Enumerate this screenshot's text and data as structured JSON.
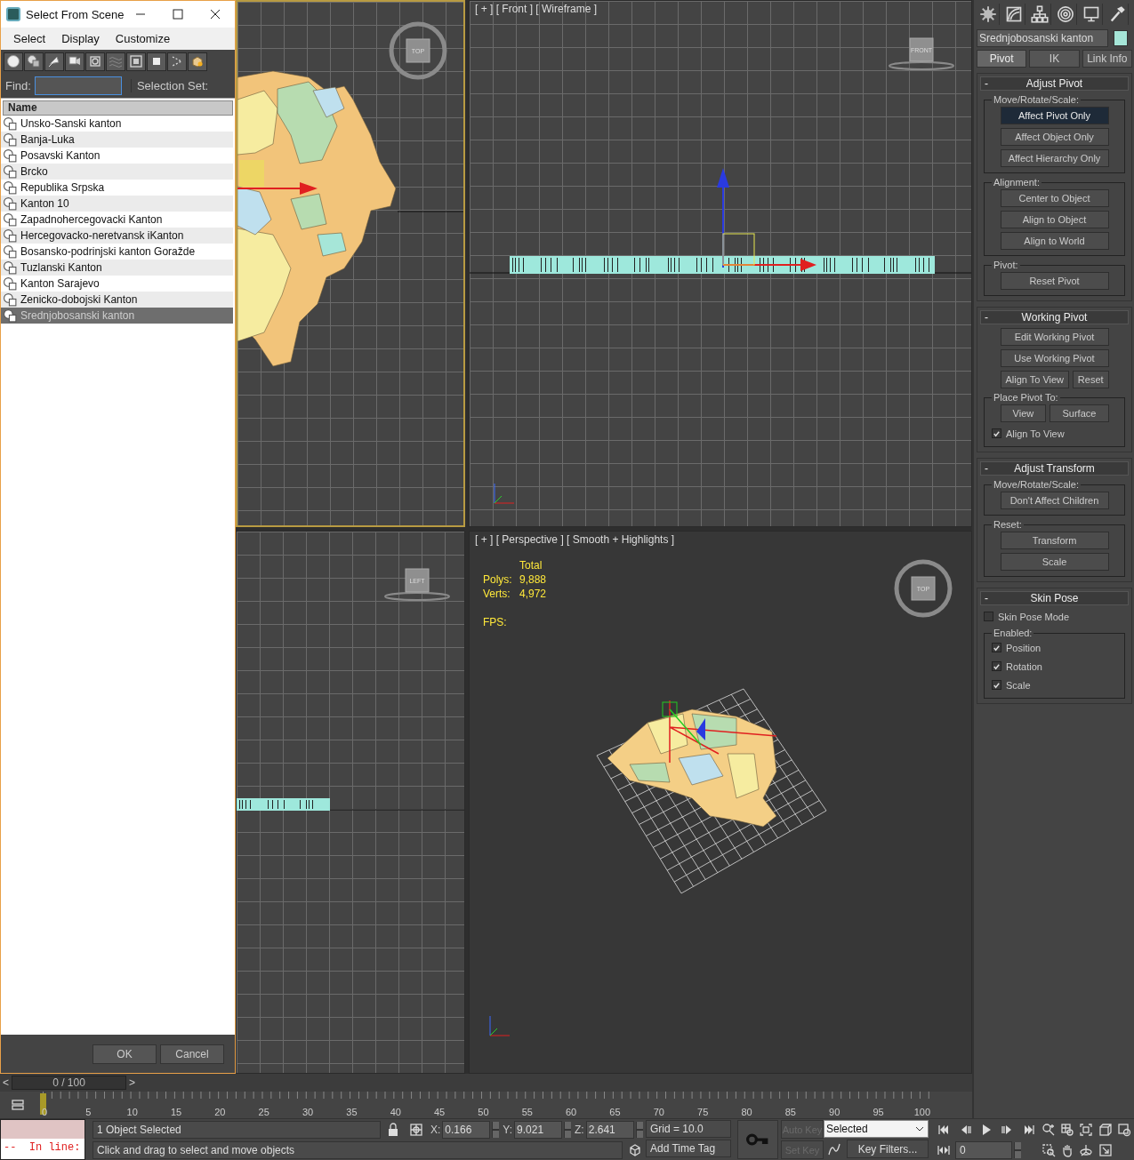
{
  "dialog": {
    "title": "Select From Scene",
    "menu": [
      "Select",
      "Display",
      "Customize"
    ],
    "find_label": "Find:",
    "selection_set_label": "Selection Set:",
    "column": "Name",
    "rows": [
      {
        "name": "Unsko-Sanski kanton",
        "selected": false
      },
      {
        "name": "Banja-Luka",
        "selected": false
      },
      {
        "name": "Posavski Kanton",
        "selected": false
      },
      {
        "name": "Brcko",
        "selected": false
      },
      {
        "name": "Republika Srpska",
        "selected": false
      },
      {
        "name": "Kanton 10",
        "selected": false
      },
      {
        "name": "Zapadnohercegovacki Kanton",
        "selected": false
      },
      {
        "name": "Hercegovacko-neretvansk iKanton",
        "selected": false
      },
      {
        "name": "Bosansko-podrinjski kanton Goražde",
        "selected": false
      },
      {
        "name": "Tuzlanski Kanton",
        "selected": false
      },
      {
        "name": "Kanton Sarajevo",
        "selected": false
      },
      {
        "name": "Zenicko-dobojski Kanton",
        "selected": false
      },
      {
        "name": "Srednjobosanski kanton",
        "selected": true
      }
    ],
    "buttons": [
      "OK",
      "Cancel"
    ]
  },
  "viewports": [
    {
      "kind": "top",
      "active": true,
      "cube_label": "TOP"
    },
    {
      "kind": "front",
      "active": false,
      "label": "[ + ] [ Front ] [ Wireframe ]",
      "cube_label": "FRONT"
    },
    {
      "kind": "left",
      "active": false,
      "cube_label": "LEFT"
    },
    {
      "kind": "perspective",
      "active": false,
      "label": "[ + ] [ Perspective ] [ Smooth + Highlights ]",
      "cube_label": "TOP",
      "stats": {
        "header": "Total",
        "rows": [
          {
            "label": "Polys:",
            "value": "9,888"
          },
          {
            "label": "Verts:",
            "value": "4,972"
          }
        ],
        "fps": "FPS:"
      }
    }
  ],
  "command_panel": {
    "object": {
      "name": "Srednjobosanski kanton",
      "color": "#a6e6d8"
    },
    "tabs": [
      {
        "label": "Pivot",
        "selected": true
      },
      {
        "label": "IK",
        "selected": false
      },
      {
        "label": "Link Info",
        "selected": false
      }
    ],
    "rollouts": [
      {
        "title": "Adjust Pivot",
        "collapse": "-",
        "items": [
          {
            "kind": "group",
            "title": "Move/Rotate/Scale:",
            "items": [
              {
                "kind": "button",
                "label": "Affect Pivot Only",
                "selected": true
              },
              {
                "kind": "button",
                "label": "Affect Object Only",
                "selected": false
              },
              {
                "kind": "button",
                "label": "Affect Hierarchy Only",
                "selected": false
              }
            ]
          },
          {
            "kind": "group",
            "title": "Alignment:",
            "items": [
              {
                "kind": "button",
                "label": "Center to Object"
              },
              {
                "kind": "button",
                "label": "Align to Object"
              },
              {
                "kind": "button",
                "label": "Align to World"
              }
            ]
          },
          {
            "kind": "group",
            "title": "Pivot:",
            "items": [
              {
                "kind": "button",
                "label": "Reset Pivot"
              }
            ]
          }
        ]
      },
      {
        "title": "Working Pivot",
        "collapse": "-",
        "items": [
          {
            "kind": "button",
            "label": "Edit Working Pivot"
          },
          {
            "kind": "button",
            "label": "Use Working Pivot"
          },
          {
            "kind": "button_row",
            "buttons": [
              "Align To View",
              "Reset"
            ]
          },
          {
            "kind": "group",
            "title": "Place Pivot To:",
            "items": [
              {
                "kind": "button_row",
                "buttons": [
                  "View",
                  "Surface"
                ]
              },
              {
                "kind": "checkbox",
                "label": "Align To View",
                "checked": true
              }
            ]
          }
        ]
      },
      {
        "title": "Adjust Transform",
        "collapse": "-",
        "items": [
          {
            "kind": "group",
            "title": "Move/Rotate/Scale:",
            "items": [
              {
                "kind": "button",
                "label": "Don't Affect Children"
              }
            ]
          },
          {
            "kind": "group",
            "title": "Reset:",
            "items": [
              {
                "kind": "button",
                "label": "Transform"
              },
              {
                "kind": "button",
                "label": "Scale"
              }
            ]
          }
        ]
      },
      {
        "title": "Skin Pose",
        "collapse": "-",
        "items": [
          {
            "kind": "checkbox",
            "label": "Skin Pose Mode",
            "checked": false
          },
          {
            "kind": "group",
            "title": "Enabled:",
            "items": [
              {
                "kind": "checkbox",
                "label": "Position",
                "checked": true
              },
              {
                "kind": "checkbox",
                "label": "Rotation",
                "checked": true
              },
              {
                "kind": "checkbox",
                "label": "Scale",
                "checked": true
              }
            ]
          }
        ]
      }
    ]
  },
  "time_slider": {
    "prev": "<",
    "label": "0 / 100",
    "next": ">"
  },
  "track_bar": {
    "ticks": [
      "0",
      "5",
      "10",
      "15",
      "20",
      "25",
      "30",
      "35",
      "40",
      "45",
      "50",
      "55",
      "60",
      "65",
      "70",
      "75",
      "80",
      "85",
      "90",
      "95",
      "100"
    ]
  },
  "status": {
    "script_prompt": "--  In line:",
    "selection": "1 Object Selected",
    "prompt": "Click and drag to select and move objects",
    "coords": [
      {
        "axis": "X:",
        "value": "0.166"
      },
      {
        "axis": "Y:",
        "value": "9.021"
      },
      {
        "axis": "Z:",
        "value": "2.641"
      }
    ],
    "grid": "Grid = 10.0",
    "time_tag": "Add Time Tag",
    "auto_key": {
      "label": "Auto Key",
      "disabled": true
    },
    "set_key": {
      "label": "Set Key",
      "disabled": true
    },
    "key_mode": "Selected",
    "key_filters": "Key Filters...",
    "frame": "0"
  }
}
